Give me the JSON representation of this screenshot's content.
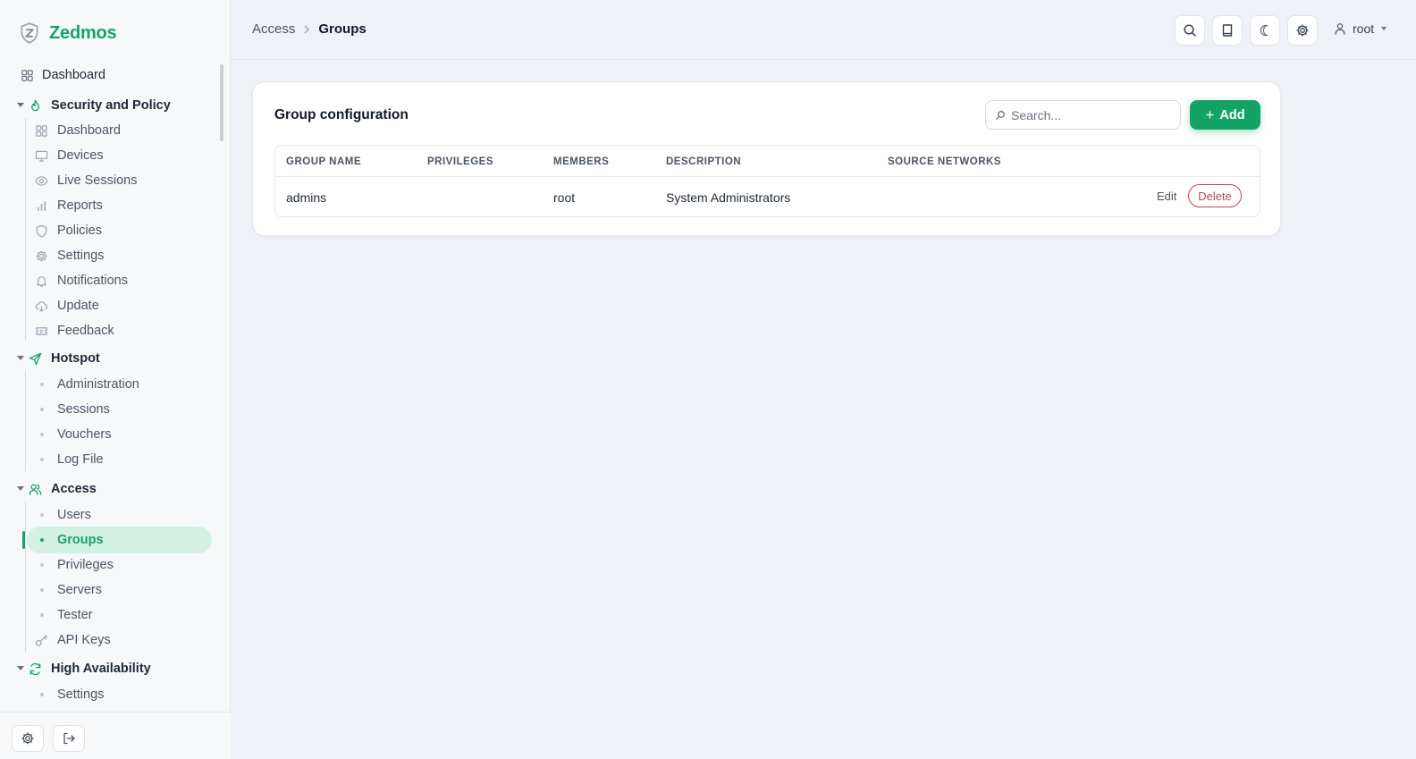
{
  "app": {
    "name": "Zedmos"
  },
  "sidebar": {
    "dashboard_label": "Dashboard",
    "sections": [
      {
        "label": "Security and Policy",
        "icon": "flame-icon",
        "items": [
          {
            "label": "Dashboard",
            "icon": "grid-icon"
          },
          {
            "label": "Devices",
            "icon": "monitor-icon"
          },
          {
            "label": "Live Sessions",
            "icon": "eye-icon"
          },
          {
            "label": "Reports",
            "icon": "bar-chart-icon"
          },
          {
            "label": "Policies",
            "icon": "shield-icon"
          },
          {
            "label": "Settings",
            "icon": "gear-icon"
          },
          {
            "label": "Notifications",
            "icon": "bell-icon"
          },
          {
            "label": "Update",
            "icon": "cloud-download-icon"
          },
          {
            "label": "Feedback",
            "icon": "ticket-icon"
          }
        ]
      },
      {
        "label": "Hotspot",
        "icon": "send-icon",
        "items": [
          {
            "label": "Administration"
          },
          {
            "label": "Sessions"
          },
          {
            "label": "Vouchers"
          },
          {
            "label": "Log File"
          }
        ]
      },
      {
        "label": "Access",
        "icon": "users-icon",
        "items": [
          {
            "label": "Users"
          },
          {
            "label": "Groups",
            "active": true
          },
          {
            "label": "Privileges"
          },
          {
            "label": "Servers"
          },
          {
            "label": "Tester"
          },
          {
            "label": "API Keys",
            "icon": "key-icon"
          }
        ]
      },
      {
        "label": "High Availability",
        "icon": "refresh-icon",
        "items": [
          {
            "label": "Settings"
          }
        ]
      }
    ],
    "footer": {
      "settings_icon": "gear-icon",
      "logout_icon": "logout-icon"
    }
  },
  "header": {
    "breadcrumb": {
      "parent": "Access",
      "current": "Groups"
    },
    "icons": [
      "search-icon",
      "book-icon",
      "moon-icon",
      "gear-icon"
    ],
    "user": {
      "name": "root",
      "icon": "user-icon"
    }
  },
  "main": {
    "card_title": "Group configuration",
    "search": {
      "placeholder": "Search...",
      "value": ""
    },
    "add_label": "Add",
    "table": {
      "columns": [
        "GROUP NAME",
        "PRIVILEGES",
        "MEMBERS",
        "DESCRIPTION",
        "SOURCE NETWORKS"
      ],
      "rows": [
        {
          "group_name": "admins",
          "privileges": "",
          "members": "root",
          "description": "System Administrators",
          "source_networks": ""
        }
      ],
      "edit_label": "Edit",
      "delete_label": "Delete"
    }
  },
  "colors": {
    "accent": "#16a36b",
    "delete": "#b84a55",
    "active_bg": "#d3f1e3"
  }
}
